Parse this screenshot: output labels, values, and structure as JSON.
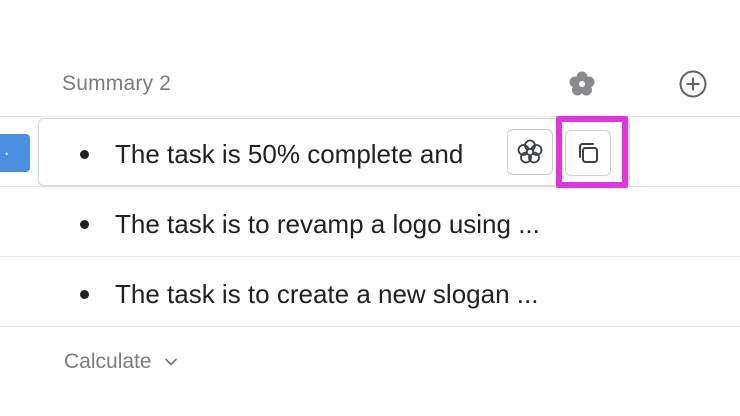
{
  "column": {
    "title": "Summary 2",
    "ai_icon": "ai-sparkle-icon",
    "add_icon": "plus-circle-icon"
  },
  "left_chip": {
    "text": "."
  },
  "rows": [
    {
      "text": "The task is 50% complete and"
    },
    {
      "text": "The task is to revamp a logo using ..."
    },
    {
      "text": "The task is to create a new slogan ..."
    }
  ],
  "cell_actions": {
    "ai_icon": "ai-sparkle-icon",
    "copy_icon": "copy-icon"
  },
  "footer": {
    "calculate_label": "Calculate",
    "chevron_icon": "chevron-down-icon"
  },
  "colors": {
    "highlight": "#e633e0",
    "left_chip": "#4a90e2"
  }
}
